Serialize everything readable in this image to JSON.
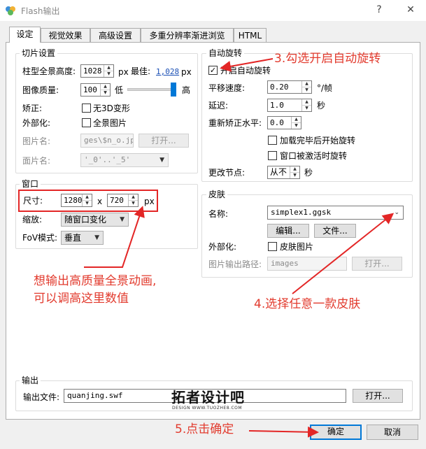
{
  "window": {
    "title": "Flash输出",
    "help_glyph": "?",
    "close_glyph": "✕"
  },
  "tabs": [
    {
      "label": "设定",
      "active": true
    },
    {
      "label": "视觉效果",
      "active": false
    },
    {
      "label": "高级设置",
      "active": false
    },
    {
      "label": "多重分辨率渐进浏览",
      "active": false
    },
    {
      "label": "HTML",
      "active": false
    }
  ],
  "slice": {
    "title": "切片设置",
    "cube_height_label": "柱型全景高度:",
    "cube_height_value": "1028",
    "px_unit": "px",
    "best_label": "最佳:",
    "best_value": "1,028",
    "best_unit": "px",
    "quality_label": "图像质量:",
    "quality_value": "100",
    "quality_low": "低",
    "quality_high": "高",
    "quality_level": 1.0,
    "correct_label": "矫正:",
    "no3d_label": "无3D变形",
    "no3d_checked": false,
    "external_label": "外部化:",
    "fullpano_label": "全景图片",
    "fullpano_checked": false,
    "imgname_label": "图片名:",
    "imgname_value": "ges\\$n_o.jpg",
    "open_label": "打开...",
    "facename_label": "面片名:",
    "facename_value": "'_0'..'_5'"
  },
  "window_group": {
    "title": "窗口",
    "size_label": "尺寸:",
    "width": "1280",
    "x_sep": "x",
    "height": "720",
    "px_unit": "px",
    "scale_label": "缩放:",
    "scale_value": "随窗口变化",
    "fov_label": "FoV模式:",
    "fov_value": "垂直"
  },
  "autorotate": {
    "title": "自动旋转",
    "enable_label": "开启自动旋转",
    "enable_checked": true,
    "pan_label": "平移速度:",
    "pan_value": "0.20",
    "pan_unit": "°/帧",
    "delay_label": "延迟:",
    "delay_value": "1.0",
    "delay_unit": "秒",
    "level_label": "重新矫正水平:",
    "level_value": "0.0",
    "after_load_label": "加载完毕后开始旋转",
    "after_load_checked": false,
    "on_activate_label": "窗口被激活时旋转",
    "on_activate_checked": false,
    "change_node_label": "更改节点:",
    "change_node_value": "从不",
    "change_node_unit": "秒"
  },
  "skin": {
    "title": "皮肤",
    "name_label": "名称:",
    "name_value": "simplex1.ggsk",
    "edit_label": "编辑...",
    "file_label": "文件...",
    "external_label": "外部化:",
    "skinimg_label": "皮肤图片",
    "skinimg_checked": false,
    "output_path_label": "图片输出路径:",
    "output_path_value": "images",
    "open_label": "打开..."
  },
  "output": {
    "title": "输出",
    "file_label": "输出文件:",
    "file_value": "quanjing.swf",
    "open_label": "打开..."
  },
  "buttons": {
    "ok": "确定",
    "cancel": "取消"
  },
  "watermark": {
    "main": "拓者设计吧",
    "sub": "DESIGN WWW.TUOZHE8.COM"
  },
  "annotations": {
    "step3": "3.勾选开启自动旋转",
    "hint_line1": "想输出高质量全景动画,",
    "hint_line2": "可以调高这里数值",
    "step4": "4.选择任意一款皮肤",
    "step5": "5.点击确定"
  },
  "colors": {
    "annotation": "#e23b2e",
    "accent": "#0078d7",
    "link": "#1a4fb5"
  }
}
